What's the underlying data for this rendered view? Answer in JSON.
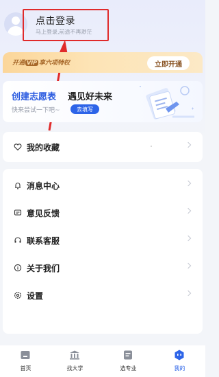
{
  "header": {
    "login_title": "点击登录",
    "login_subtitle": "马上登录,前途不再渺茫"
  },
  "vip": {
    "text_before": "开通",
    "badge": "VIP",
    "text_after": "享六项特权",
    "button": "立即开通"
  },
  "wish_card": {
    "title_blue": "创建志愿表",
    "title_black": "遇见好未来",
    "subtitle": "快来尝试一下吧~",
    "button": "去填写"
  },
  "menu": {
    "favorites": "我的收藏",
    "messages": "消息中心",
    "feedback": "意见反馈",
    "support": "联系客服",
    "about": "关于我们",
    "settings": "设置"
  },
  "nav": {
    "items": [
      {
        "label": "首页",
        "icon": "home-icon"
      },
      {
        "label": "找大学",
        "icon": "university-icon"
      },
      {
        "label": "选专业",
        "icon": "major-icon"
      },
      {
        "label": "我的",
        "icon": "profile-icon"
      }
    ],
    "active_index": 3
  },
  "colors": {
    "accent": "#2d64e8",
    "highlight_box": "#e02a2a",
    "vip_gold": "#a7682a"
  }
}
